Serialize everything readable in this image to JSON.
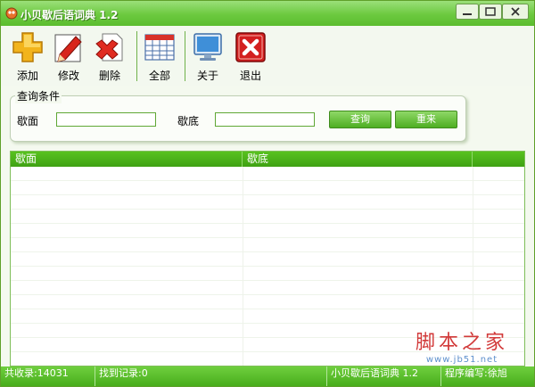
{
  "window": {
    "title": "小贝歇后语词典 1.2"
  },
  "toolbar": {
    "add": "添加",
    "edit": "修改",
    "delete": "删除",
    "all": "全部",
    "about": "关于",
    "exit": "退出"
  },
  "query": {
    "group_title": "查询条件",
    "face_label": "歇面",
    "face_value": "",
    "bottom_label": "歇底",
    "bottom_value": "",
    "search_button": "查询",
    "reset_button": "重来"
  },
  "table": {
    "columns": [
      "歇面",
      "歇底",
      ""
    ],
    "rows": []
  },
  "watermark": {
    "line1": "脚本之家",
    "line2": "www.jb51.net"
  },
  "status": {
    "total": "共收录:14031",
    "found": "找到记录:0",
    "app": "小贝歇后语词典 1.2",
    "author": "程序编写:徐旭"
  },
  "colors": {
    "accent": "#4cb81e",
    "header": "#3fa113",
    "exit_icon": "#d31f1f"
  }
}
